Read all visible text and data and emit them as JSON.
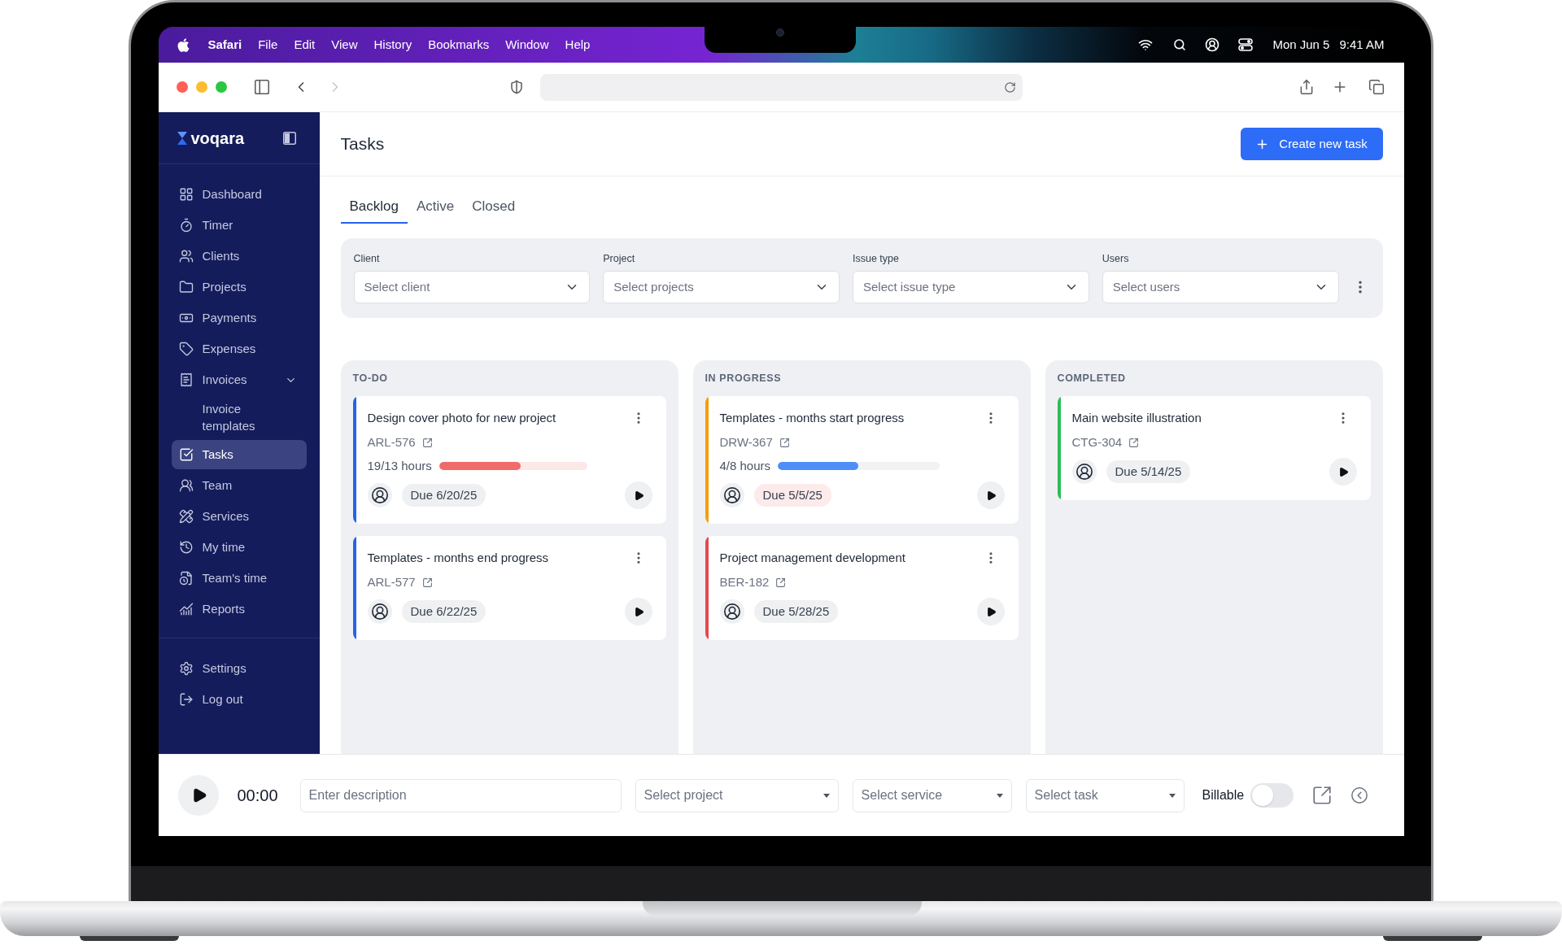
{
  "menu_bar": {
    "app": "Safari",
    "menus": [
      "File",
      "Edit",
      "View",
      "History",
      "Bookmarks",
      "Window",
      "Help"
    ],
    "date": "Mon Jun 5",
    "time": "9:41 AM"
  },
  "browser": {
    "back_disabled": false,
    "forward_disabled": true
  },
  "sidebar": {
    "logo": "voqara",
    "items": [
      {
        "label": "Dashboard",
        "selected": false
      },
      {
        "label": "Timer",
        "selected": false
      },
      {
        "label": "Clients",
        "selected": false
      },
      {
        "label": "Projects",
        "selected": false
      },
      {
        "label": "Payments",
        "selected": false
      },
      {
        "label": "Expenses",
        "selected": false
      },
      {
        "label": "Invoices",
        "selected": false,
        "expanded": true,
        "children": [
          {
            "label": "Invoice templates",
            "selected": false
          }
        ]
      },
      {
        "label": "Tasks",
        "selected": true
      },
      {
        "label": "Team",
        "selected": false
      },
      {
        "label": "Services",
        "selected": false
      },
      {
        "label": "My time",
        "selected": false
      },
      {
        "label": "Team's time",
        "selected": false
      },
      {
        "label": "Reports",
        "selected": false
      }
    ],
    "footer_items": [
      {
        "label": "Settings",
        "selected": false
      },
      {
        "label": "Log out",
        "selected": false
      }
    ]
  },
  "header": {
    "title": "Tasks",
    "create_button": "Create new task"
  },
  "tabs": [
    {
      "label": "Backlog",
      "selected": true
    },
    {
      "label": "Active",
      "selected": false
    },
    {
      "label": "Closed",
      "selected": false
    }
  ],
  "filters": [
    {
      "label": "Client",
      "placeholder": "Select client"
    },
    {
      "label": "Project",
      "placeholder": "Select projects"
    },
    {
      "label": "Issue type",
      "placeholder": "Select issue type"
    },
    {
      "label": "Users",
      "placeholder": "Select users"
    }
  ],
  "columns": [
    {
      "title": "TO-DO",
      "cards": [
        {
          "title": "Design cover photo for new project",
          "code": "ARL-576",
          "color": "#2563eb",
          "progress": {
            "reading": "19/13 hours",
            "level": 0.55,
            "over_budget": true
          },
          "due": "Due 6/20/25",
          "overdue": false
        },
        {
          "title": "Templates - months end progress",
          "code": "ARL-577",
          "color": "#2563eb",
          "due": "Due 6/22/25",
          "overdue": false
        }
      ]
    },
    {
      "title": "IN PROGRESS",
      "cards": [
        {
          "title": "Templates - months start progress",
          "code": "DRW-367",
          "color": "#f59e0b",
          "progress": {
            "reading": "4/8 hours",
            "level": 0.5,
            "over_budget": false
          },
          "due": "Due 5/5/25",
          "overdue": true
        },
        {
          "title": "Project management development",
          "code": "BER-182",
          "color": "#e5484d",
          "due": "Due 5/28/25",
          "overdue": false
        }
      ]
    },
    {
      "title": "COMPLETED",
      "cards": [
        {
          "title": "Main website illustration",
          "code": "CTG-304",
          "color": "#2dbd55",
          "due": "Due 5/14/25",
          "overdue": false
        }
      ]
    }
  ],
  "timer_bar": {
    "time": "00:00",
    "description": {
      "placeholder": "Enter description"
    },
    "selects": [
      {
        "placeholder": "Select project"
      },
      {
        "placeholder": "Select service"
      },
      {
        "placeholder": "Select task"
      }
    ],
    "billable": {
      "label": "Billable",
      "on": false
    }
  }
}
